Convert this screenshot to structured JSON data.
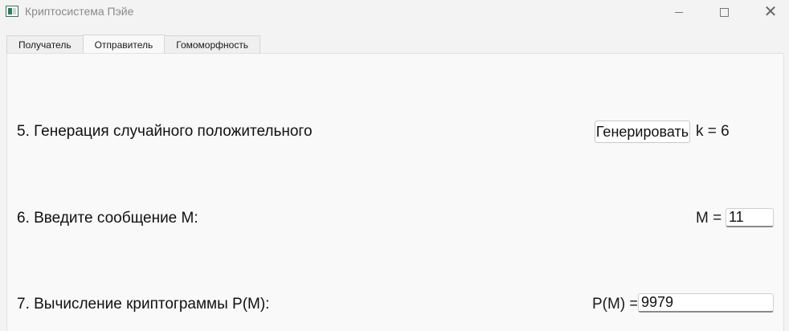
{
  "window": {
    "title": "Криптосистема Пэйе",
    "icon": "app-icon"
  },
  "tabs": [
    {
      "label": "Получатель",
      "active": false
    },
    {
      "label": "Отправитель",
      "active": true
    },
    {
      "label": "Гомоморфность",
      "active": false
    }
  ],
  "steps": {
    "step5": {
      "label": "5. Генерация случайного положительного",
      "button_label": "Генерировать",
      "result_text": "k = 6"
    },
    "step6": {
      "label": "6. Введите сообщение M:",
      "field_label": "M =",
      "field_value": "11"
    },
    "step7": {
      "label": "7. Вычисление криптограммы P(M):",
      "field_label": "P(M) =",
      "field_value": "9979"
    }
  }
}
